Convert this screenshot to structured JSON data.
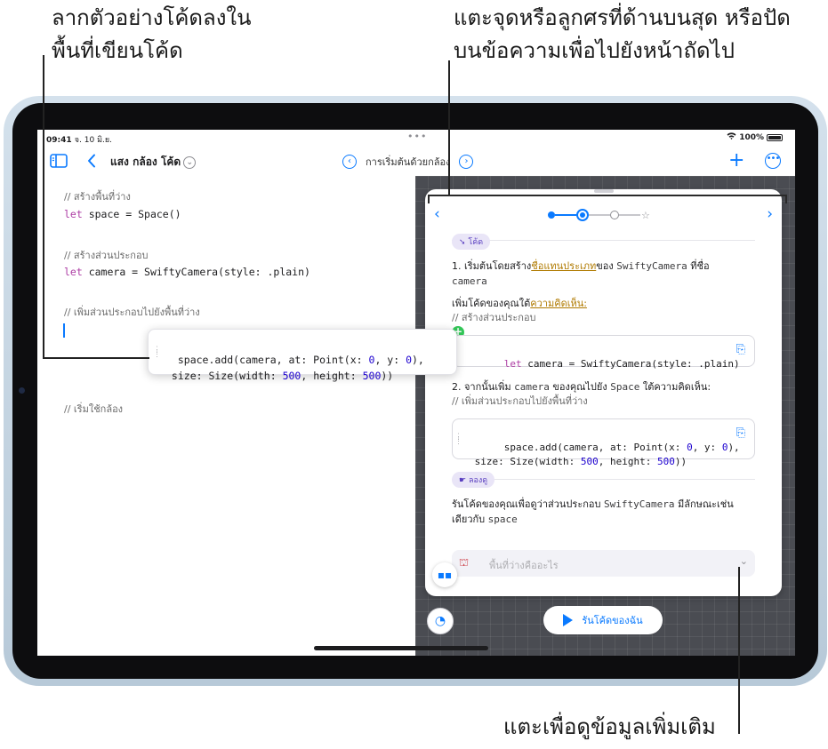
{
  "callouts": {
    "drag_line1": "ลากตัวอย่างโค้ดลงใน",
    "drag_line2": "พื้นที่เขียนโค้ด",
    "tap_line1": "แตะจุดหรือลูกศรที่ด้านบนสุด หรือปัด",
    "tap_line2": "บนข้อความเพื่อไปยังหน้าถัดไป",
    "more_info": "แตะเพื่อดูข้อมูลเพิ่มเติม"
  },
  "status_bar": {
    "time": "09:41",
    "date": "จ. 10 มิ.ย.",
    "dots": "•••",
    "battery": "100%"
  },
  "nav": {
    "title": "แสง กล้อง โค้ด",
    "page_title": "การเริ่มต้นด้วยกล้อง",
    "add_icon": "+"
  },
  "editor": {
    "line1_comment": "// สร้างพื้นที่ว่าง",
    "line2_kw": "let",
    "line2_rest": " space = Space()",
    "line3_comment": "// สร้างส่วนประกอบ",
    "line4_kw": "let",
    "line4_rest": " camera = SwiftyCamera(style: .plain)",
    "line5_comment": "// เพิ่มส่วนประกอบไปยังพื้นที่ว่าง",
    "line6_comment": "// เริ่มใช้กล้อง"
  },
  "drag_snippet": {
    "l1_a": "space.add(camera, at: Point(x: ",
    "l1_n1": "0",
    "l1_b": ", y: ",
    "l1_n2": "0",
    "l1_c": "),",
    "l2_a": " size: Size(width: ",
    "l2_n1": "500",
    "l2_b": ", height: ",
    "l2_n2": "500",
    "l2_c": "))"
  },
  "guide": {
    "code_pill": "โค้ด",
    "step1_a": "1. เริ่มต้นโดยสร้าง",
    "step1_link": "ชื่อแทนประเภท",
    "step1_b": "ของ ",
    "step1_mono": "SwiftyCamera",
    "step1_c": " ที่ชื่อ",
    "step1_mono2": "camera",
    "add_code_a": "เพิ่มโค้ดของคุณใต้",
    "add_code_link": "ความคิดเห็น:",
    "comment1": "// สร้างส่วนประกอบ",
    "card1_kw": "let",
    "card1_rest": " camera = SwiftyCamera(style: .plain)",
    "step2_a": "2. จากนั้นเพิ่ม ",
    "step2_mono": "camera",
    "step2_b": " ของคุณไปยัง ",
    "step2_mono2": "Space",
    "step2_c": " ใต้ความคิดเห็น:",
    "comment2": "// เพิ่มส่วนประกอบไปยังพื้นที่ว่าง",
    "try_pill": "ลองดู",
    "run_text_a": "รันโค้ดของคุณเพื่อดูว่าส่วนประกอบ ",
    "run_text_mono": "SwiftyCamera",
    "run_text_b": " มีลักษณะเช่น",
    "run_text_c": "เดียวกับ ",
    "run_text_mono2": "space",
    "more_row": "พื้นที่ว่างคืออะไร"
  },
  "run_button": "รันโค้ดของฉัน",
  "colors": {
    "accent": "#0a7aff",
    "keyword": "#ad3da4",
    "number": "#1c00cf",
    "link": "#b07a00"
  }
}
